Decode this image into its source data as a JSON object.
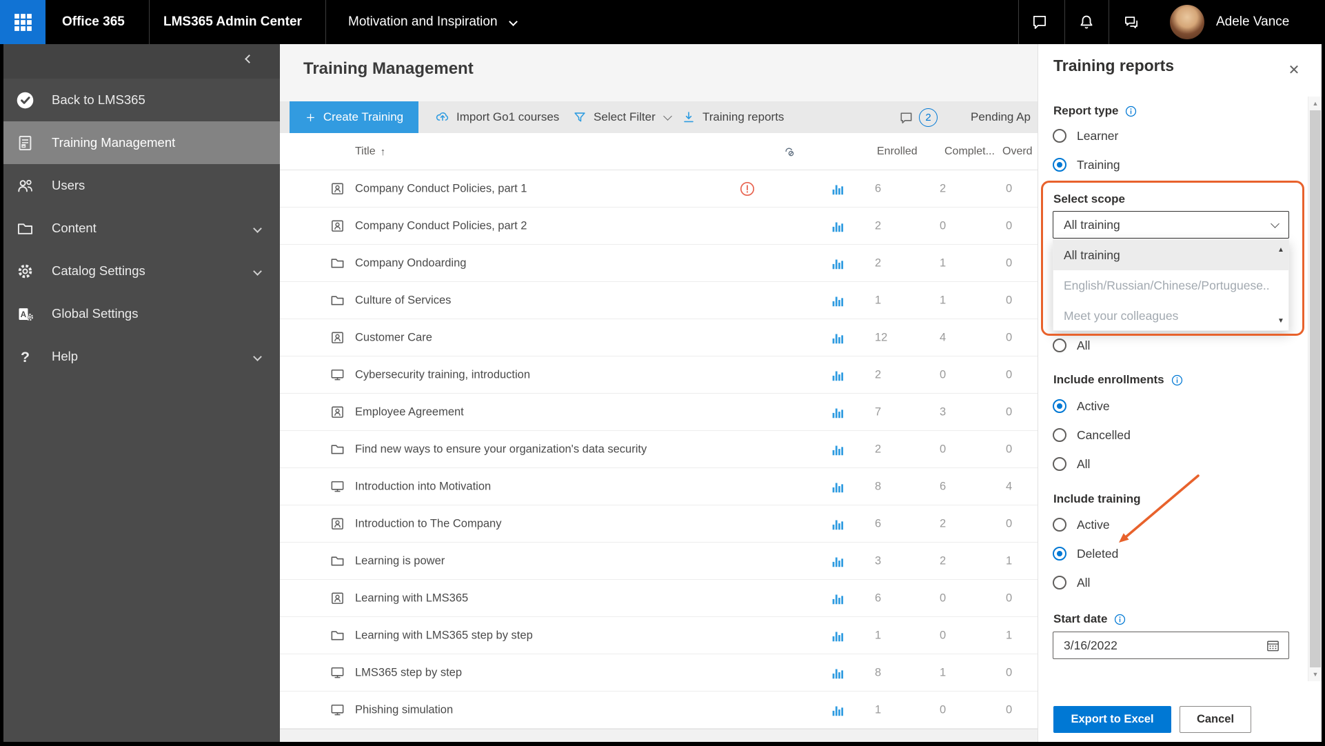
{
  "topbar": {
    "product": "Office 365",
    "admin_center": "LMS365 Admin Center",
    "context_switcher": "Motivation and Inspiration",
    "user_name": "Adele Vance"
  },
  "sidebar": {
    "items": [
      {
        "label": "Back to LMS365",
        "icon": "logo",
        "selected": false,
        "expandable": false
      },
      {
        "label": "Training Management",
        "icon": "doclist",
        "selected": true,
        "expandable": false
      },
      {
        "label": "Users",
        "icon": "users",
        "selected": false,
        "expandable": false
      },
      {
        "label": "Content",
        "icon": "folder",
        "selected": false,
        "expandable": true
      },
      {
        "label": "Catalog Settings",
        "icon": "gear",
        "selected": false,
        "expandable": true
      },
      {
        "label": "Global Settings",
        "icon": "admin",
        "selected": false,
        "expandable": false
      },
      {
        "label": "Help",
        "icon": "help",
        "selected": false,
        "expandable": true
      }
    ]
  },
  "page": {
    "title": "Training Management"
  },
  "toolbar": {
    "create_training": "Create Training",
    "import_go1": "Import Go1 courses",
    "select_filter": "Select Filter",
    "training_reports": "Training reports",
    "comments_count": "2",
    "pending_approvals": "Pending Ap"
  },
  "table": {
    "columns": {
      "title": "Title",
      "enrolled": "Enrolled",
      "completed": "Complet...",
      "overdue": "Overd"
    },
    "rows": [
      {
        "title": "Company Conduct Policies, part 1",
        "icon": "person",
        "warning": true,
        "enrolled": "6",
        "completed": "2",
        "overdue": "0"
      },
      {
        "title": "Company Conduct Policies, part 2",
        "icon": "person",
        "warning": false,
        "enrolled": "2",
        "completed": "0",
        "overdue": "0"
      },
      {
        "title": "Company Ondoarding",
        "icon": "folder",
        "warning": false,
        "enrolled": "2",
        "completed": "1",
        "overdue": "0"
      },
      {
        "title": "Culture of Services",
        "icon": "folder",
        "warning": false,
        "enrolled": "1",
        "completed": "1",
        "overdue": "0"
      },
      {
        "title": "Customer Care",
        "icon": "person",
        "warning": false,
        "enrolled": "12",
        "completed": "4",
        "overdue": "0"
      },
      {
        "title": "Cybersecurity training, introduction",
        "icon": "monitor",
        "warning": false,
        "enrolled": "2",
        "completed": "0",
        "overdue": "0"
      },
      {
        "title": "Employee Agreement",
        "icon": "person",
        "warning": false,
        "enrolled": "7",
        "completed": "3",
        "overdue": "0"
      },
      {
        "title": "Find new ways to ensure your organization's data security",
        "icon": "folder",
        "warning": false,
        "enrolled": "2",
        "completed": "0",
        "overdue": "0"
      },
      {
        "title": "Introduction into Motivation",
        "icon": "monitor",
        "warning": false,
        "enrolled": "8",
        "completed": "6",
        "overdue": "4"
      },
      {
        "title": "Introduction to The Company",
        "icon": "person",
        "warning": false,
        "enrolled": "6",
        "completed": "2",
        "overdue": "0"
      },
      {
        "title": "Learning is power",
        "icon": "folder",
        "warning": false,
        "enrolled": "3",
        "completed": "2",
        "overdue": "1"
      },
      {
        "title": "Learning with LMS365",
        "icon": "person",
        "warning": false,
        "enrolled": "6",
        "completed": "0",
        "overdue": "0"
      },
      {
        "title": "Learning with LMS365 step by step",
        "icon": "folder",
        "warning": false,
        "enrolled": "1",
        "completed": "0",
        "overdue": "1"
      },
      {
        "title": "LMS365 step by step",
        "icon": "monitor",
        "warning": false,
        "enrolled": "8",
        "completed": "1",
        "overdue": "0"
      },
      {
        "title": "Phishing simulation",
        "icon": "monitor",
        "warning": false,
        "enrolled": "1",
        "completed": "0",
        "overdue": "0"
      }
    ]
  },
  "panel": {
    "title": "Training reports",
    "report_type": {
      "label": "Report type",
      "options": [
        {
          "label": "Learner",
          "selected": false
        },
        {
          "label": "Training",
          "selected": true
        }
      ]
    },
    "scope": {
      "label": "Select scope",
      "value": "All training",
      "options": [
        {
          "label": "All training",
          "highlighted": true
        },
        {
          "label": "English/Russian/Chinese/Portuguese...",
          "highlighted": false
        },
        {
          "label": "Meet your colleagues",
          "highlighted": false
        }
      ]
    },
    "scope_all": {
      "label": "All",
      "selected": false
    },
    "include_enrollments": {
      "label": "Include enrollments",
      "options": [
        {
          "label": "Active",
          "selected": true
        },
        {
          "label": "Cancelled",
          "selected": false
        },
        {
          "label": "All",
          "selected": false
        }
      ]
    },
    "include_training": {
      "label": "Include training",
      "options": [
        {
          "label": "Active",
          "selected": false
        },
        {
          "label": "Deleted",
          "selected": true
        },
        {
          "label": "All",
          "selected": false
        }
      ]
    },
    "start_date": {
      "label": "Start date",
      "value": "3/16/2022"
    },
    "actions": {
      "export": "Export to Excel",
      "cancel": "Cancel"
    }
  },
  "colors": {
    "accent": "#0078d4",
    "toolbar_blue": "#329be0",
    "annotation_orange": "#e8622c",
    "warning_red": "#e86450"
  }
}
